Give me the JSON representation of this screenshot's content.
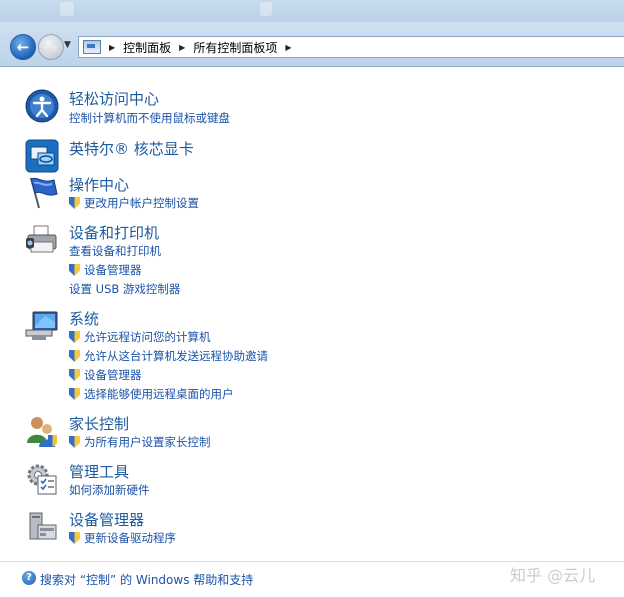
{
  "nav": {
    "back_icon": "back-arrow-icon",
    "forward_icon": "forward-arrow-icon",
    "breadcrumb": [
      "控制面板",
      "所有控制面板项"
    ]
  },
  "items": [
    {
      "title": "轻松访问中心",
      "icon": "ease-of-access-icon",
      "links": [
        {
          "text": "控制计算机而不使用鼠标或键盘",
          "shield": false
        }
      ]
    },
    {
      "title": "英特尔® 核芯显卡",
      "icon": "intel-graphics-icon",
      "links": []
    },
    {
      "title": "操作中心",
      "icon": "action-center-flag-icon",
      "links": [
        {
          "text": "更改用户帐户控制设置",
          "shield": true
        }
      ]
    },
    {
      "title": "设备和打印机",
      "icon": "printer-icon",
      "links": [
        {
          "text": "查看设备和打印机",
          "shield": false
        },
        {
          "text": "设备管理器",
          "shield": true
        },
        {
          "text": "设置 USB 游戏控制器",
          "shield": false
        }
      ]
    },
    {
      "title": "系统",
      "icon": "system-computer-icon",
      "links": [
        {
          "text": "允许远程访问您的计算机",
          "shield": true
        },
        {
          "text": "允许从这台计算机发送远程协助邀请",
          "shield": true
        },
        {
          "text": "设备管理器",
          "shield": true
        },
        {
          "text": "选择能够使用远程桌面的用户",
          "shield": true
        }
      ]
    },
    {
      "title": "家长控制",
      "icon": "parental-controls-icon",
      "links": [
        {
          "text": "为所有用户设置家长控制",
          "shield": true
        }
      ]
    },
    {
      "title": "管理工具",
      "icon": "admin-tools-icon",
      "links": [
        {
          "text": "如何添加新硬件",
          "shield": false
        }
      ]
    },
    {
      "title": "设备管理器",
      "icon": "device-manager-icon",
      "links": [
        {
          "text": "更新设备驱动程序",
          "shield": true
        }
      ]
    }
  ],
  "footer": {
    "help_text": "搜索对 “控制” 的 Windows 帮助和支持",
    "watermark": "知乎 @云儿"
  }
}
